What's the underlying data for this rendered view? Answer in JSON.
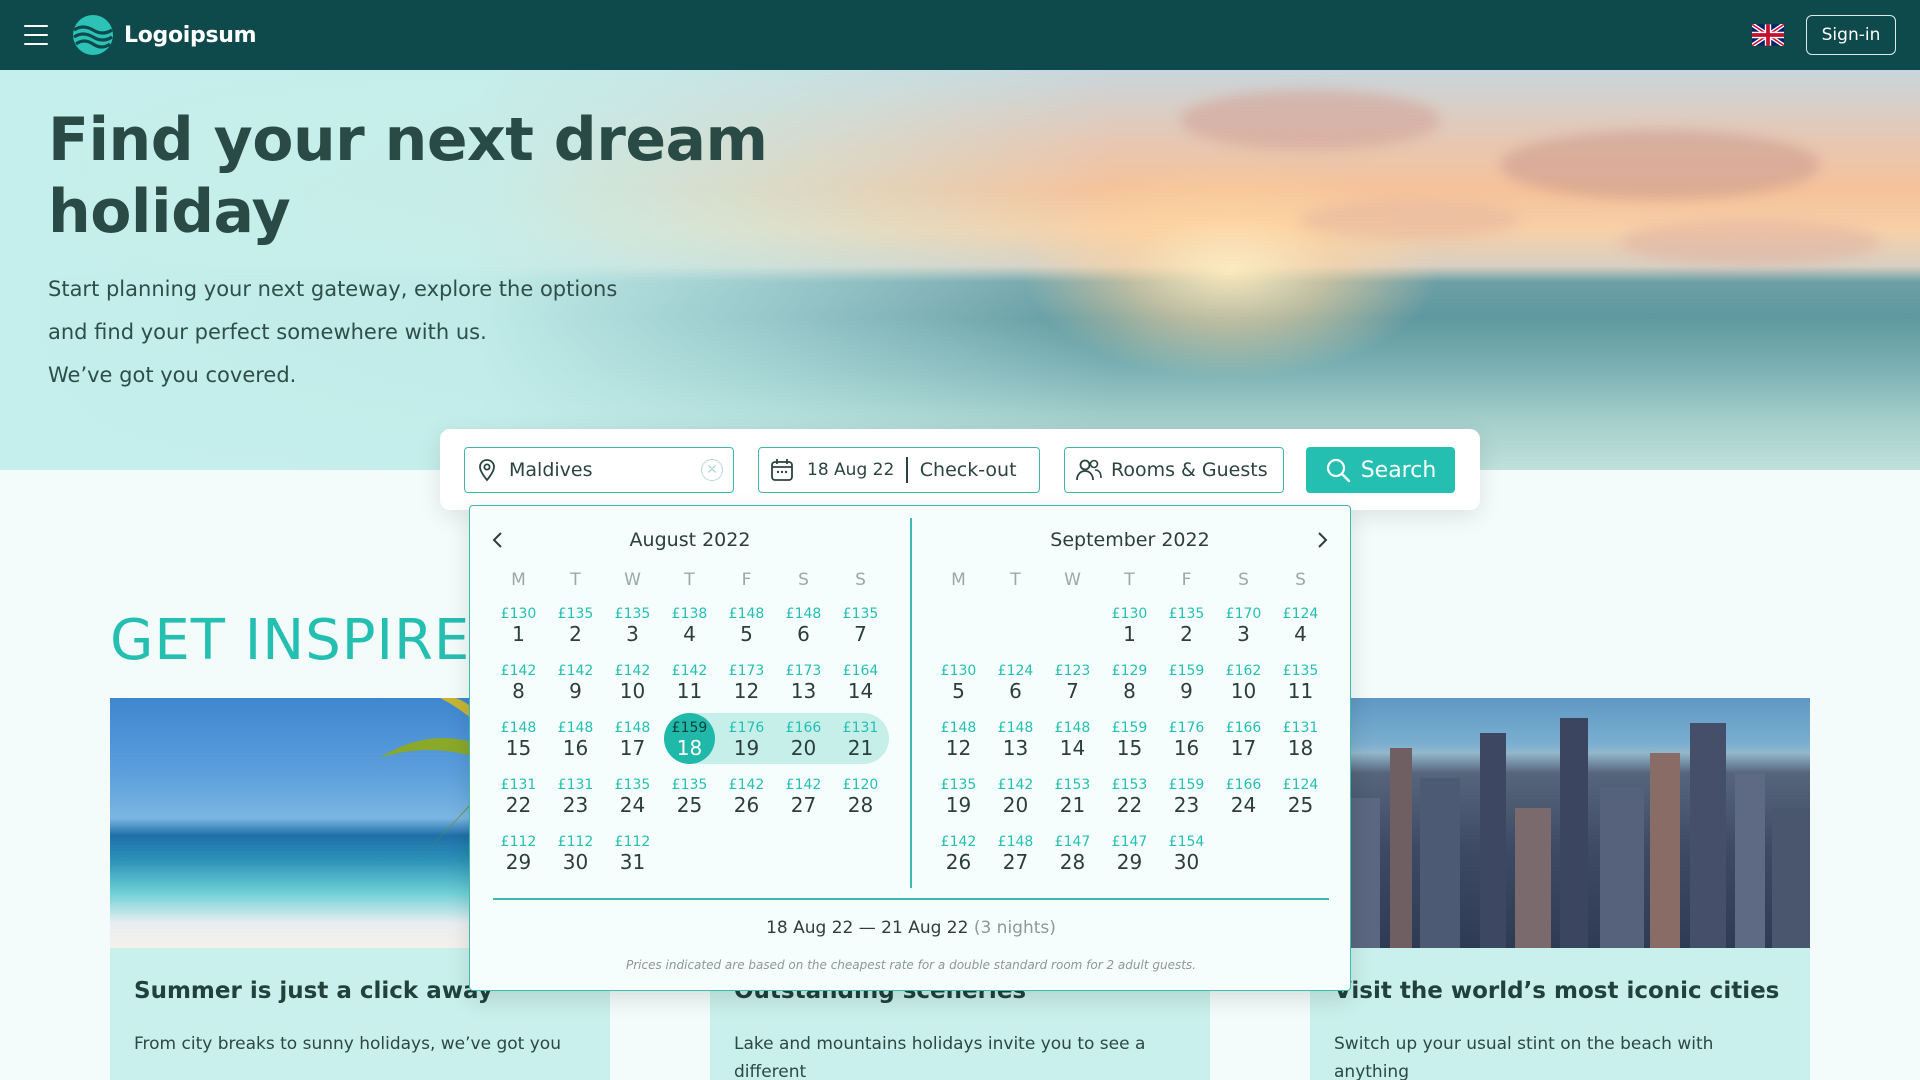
{
  "header": {
    "logo_text": "Logoipsum",
    "signin_label": "Sign-in",
    "bg_color": "#0e4a4c",
    "icons": [
      "menu-icon",
      "logo-waves-icon",
      "uk-flag-icon"
    ]
  },
  "hero": {
    "title": "Find your next dream holiday",
    "subtitle_lines": [
      "Start planning your next gateway, explore the options",
      "and find your perfect somewhere with us.",
      "We’ve got you covered."
    ]
  },
  "search": {
    "destination_value": "Maldives",
    "checkin_value": "18 Aug 22",
    "checkout_placeholder": "Check-out",
    "guests_label": "Rooms & Guests",
    "search_label": "Search",
    "accent_color": "#25bfb2"
  },
  "calendar": {
    "weekdays": [
      "M",
      "T",
      "W",
      "T",
      "F",
      "S",
      "S"
    ],
    "selected_start": 18,
    "selected_end": 21,
    "months": [
      {
        "title": "August 2022",
        "offset": 0,
        "days": [
          {
            "d": 1,
            "p": "£130"
          },
          {
            "d": 2,
            "p": "£135"
          },
          {
            "d": 3,
            "p": "£135"
          },
          {
            "d": 4,
            "p": "£138"
          },
          {
            "d": 5,
            "p": "£148"
          },
          {
            "d": 6,
            "p": "£148"
          },
          {
            "d": 7,
            "p": "£135"
          },
          {
            "d": 8,
            "p": "£142"
          },
          {
            "d": 9,
            "p": "£142"
          },
          {
            "d": 10,
            "p": "£142"
          },
          {
            "d": 11,
            "p": "£142"
          },
          {
            "d": 12,
            "p": "£173"
          },
          {
            "d": 13,
            "p": "£173"
          },
          {
            "d": 14,
            "p": "£164"
          },
          {
            "d": 15,
            "p": "£148"
          },
          {
            "d": 16,
            "p": "£148"
          },
          {
            "d": 17,
            "p": "£148"
          },
          {
            "d": 18,
            "p": "£159"
          },
          {
            "d": 19,
            "p": "£176"
          },
          {
            "d": 20,
            "p": "£166"
          },
          {
            "d": 21,
            "p": "£131"
          },
          {
            "d": 22,
            "p": "£131"
          },
          {
            "d": 23,
            "p": "£131"
          },
          {
            "d": 24,
            "p": "£135"
          },
          {
            "d": 25,
            "p": "£135"
          },
          {
            "d": 26,
            "p": "£142"
          },
          {
            "d": 27,
            "p": "£142"
          },
          {
            "d": 28,
            "p": "£120"
          },
          {
            "d": 29,
            "p": "£112"
          },
          {
            "d": 30,
            "p": "£112"
          },
          {
            "d": 31,
            "p": "£112"
          }
        ]
      },
      {
        "title": "September 2022",
        "offset": 3,
        "days": [
          {
            "d": 1,
            "p": "£130"
          },
          {
            "d": 2,
            "p": "£135"
          },
          {
            "d": 3,
            "p": "£170"
          },
          {
            "d": 4,
            "p": "£124"
          },
          {
            "d": 5,
            "p": "£130"
          },
          {
            "d": 6,
            "p": "£124"
          },
          {
            "d": 7,
            "p": "£123"
          },
          {
            "d": 8,
            "p": "£129"
          },
          {
            "d": 9,
            "p": "£159"
          },
          {
            "d": 10,
            "p": "£162"
          },
          {
            "d": 11,
            "p": "£135"
          },
          {
            "d": 12,
            "p": "£148"
          },
          {
            "d": 13,
            "p": "£148"
          },
          {
            "d": 14,
            "p": "£148"
          },
          {
            "d": 15,
            "p": "£159"
          },
          {
            "d": 16,
            "p": "£176"
          },
          {
            "d": 17,
            "p": "£166"
          },
          {
            "d": 18,
            "p": "£131"
          },
          {
            "d": 19,
            "p": "£135"
          },
          {
            "d": 20,
            "p": "£142"
          },
          {
            "d": 21,
            "p": "£153"
          },
          {
            "d": 22,
            "p": "£153"
          },
          {
            "d": 23,
            "p": "£159"
          },
          {
            "d": 24,
            "p": "£166"
          },
          {
            "d": 25,
            "p": "£124"
          },
          {
            "d": 26,
            "p": "£142"
          },
          {
            "d": 27,
            "p": "£148"
          },
          {
            "d": 28,
            "p": "£147"
          },
          {
            "d": 29,
            "p": "£147"
          },
          {
            "d": 30,
            "p": "£154"
          }
        ]
      }
    ],
    "summary_range": "18 Aug 22 — 21 Aug 22",
    "summary_nights": "(3 nights)",
    "disclaimer": "Prices indicated are based on the cheapest rate for a double standard room for 2 adult guests."
  },
  "inspire": {
    "heading": "GET INSPIRE",
    "cards": [
      {
        "title": "Summer is just a click away",
        "text": "From city breaks to sunny holidays, we’ve got you"
      },
      {
        "title": "Outstanding sceneries",
        "text": "Lake and mountains holidays invite you to see a different"
      },
      {
        "title": "Visit the world’s most iconic cities",
        "text": "Switch up your usual stint on the beach with anything"
      }
    ]
  }
}
